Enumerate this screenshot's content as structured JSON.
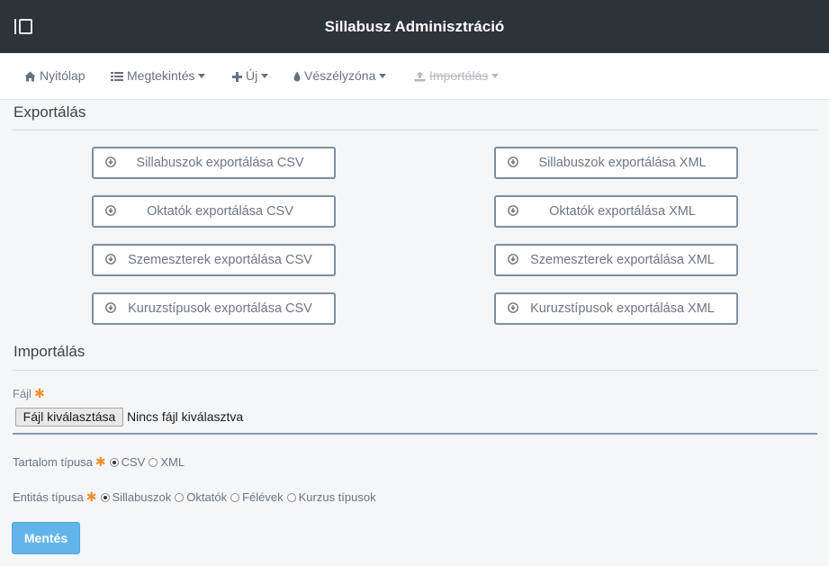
{
  "header": {
    "title": "Sillabusz Adminisztráció",
    "toggle_icon": "sidebar-toggle-icon"
  },
  "nav": {
    "home": {
      "label": "Nyitólap",
      "icon": "home-icon"
    },
    "view": {
      "label": "Megtekintés",
      "icon": "list-icon"
    },
    "new": {
      "label": "Új",
      "icon": "plus-icon"
    },
    "danger": {
      "label": "Vészélyzóna",
      "icon": "drop-icon"
    },
    "import": {
      "label": "Importálás",
      "icon": "upload-icon",
      "disabled": true
    }
  },
  "export": {
    "title": "Exportálás",
    "buttons": [
      {
        "label": "Sillabuszok exportálása CSV"
      },
      {
        "label": "Sillabuszok exportálása XML"
      },
      {
        "label": "Oktatók exportálása CSV"
      },
      {
        "label": "Oktatók exportálása XML"
      },
      {
        "label": "Szemeszterek exportálása CSV"
      },
      {
        "label": "Szemeszterek exportálása XML"
      },
      {
        "label": "Kuruzstípusok exportálása CSV"
      },
      {
        "label": "Kuruzstípusok exportálása XML"
      }
    ]
  },
  "import": {
    "title": "Importálás",
    "file_label": "Fájl",
    "required_mark": "✱",
    "file_button": "Fájl kiválasztása",
    "file_status": "Nincs fájl kiválasztva",
    "content_type": {
      "label": "Tartalom típusa",
      "options": [
        {
          "label": "CSV",
          "checked": true
        },
        {
          "label": "XML",
          "checked": false
        }
      ]
    },
    "entity_type": {
      "label": "Entitás típusa",
      "options": [
        {
          "label": "Sillabuszok",
          "checked": true
        },
        {
          "label": "Oktatók",
          "checked": false
        },
        {
          "label": "Félévek",
          "checked": false
        },
        {
          "label": "Kurzus típusok",
          "checked": false
        }
      ]
    },
    "save_label": "Mentés"
  },
  "colors": {
    "topbar": "#2c3339",
    "accent": "#61b5ea",
    "required": "#f0902c",
    "button_border": "#7d8f9e"
  }
}
